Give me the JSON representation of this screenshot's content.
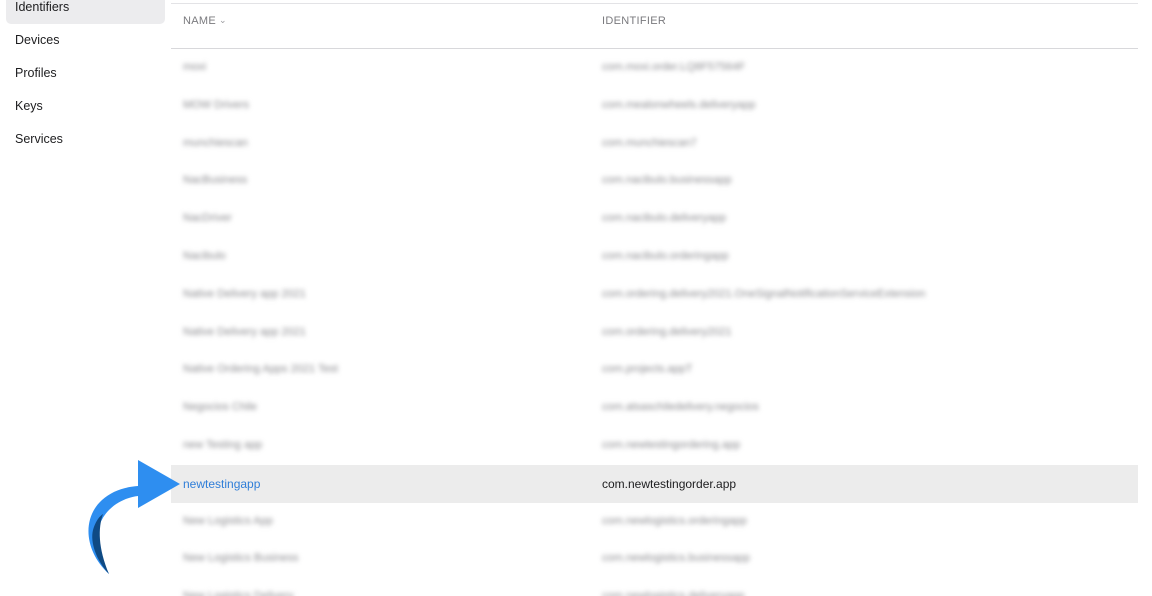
{
  "sidebar": {
    "items": [
      {
        "label": "Identifiers",
        "active": true
      },
      {
        "label": "Devices",
        "active": false
      },
      {
        "label": "Profiles",
        "active": false
      },
      {
        "label": "Keys",
        "active": false
      },
      {
        "label": "Services",
        "active": false
      }
    ]
  },
  "table": {
    "columns": {
      "name": "NAME",
      "identifier": "IDENTIFIER"
    },
    "sort_icon": "chevron-down-icon",
    "rows": [
      {
        "name": "moxi",
        "identifier": "com.moxi.order.LQ8F57564F",
        "blurred": true
      },
      {
        "name": "MOW Drivers",
        "identifier": "com.mealonwheels.deliveryapp",
        "blurred": true
      },
      {
        "name": "munchiescan",
        "identifier": "com.munchiescan7",
        "blurred": true
      },
      {
        "name": "NacBusiness",
        "identifier": "com.nacibulo.businessapp",
        "blurred": true
      },
      {
        "name": "NacDriver",
        "identifier": "com.nacibulo.deliveryapp",
        "blurred": true
      },
      {
        "name": "Nacibulo",
        "identifier": "com.nacibulo.orderingapp",
        "blurred": true
      },
      {
        "name": "Native Delivery app 2021",
        "identifier": "com.ordering.delivery2021.OneSignalNotificationServiceExtension",
        "blurred": true
      },
      {
        "name": "Native Delivery app 2021",
        "identifier": "com.ordering.delivery2021",
        "blurred": true
      },
      {
        "name": "Native Ordering Apps 2021 Test",
        "identifier": "com.projects.appT",
        "blurred": true
      },
      {
        "name": "Negocios Chile",
        "identifier": "com.atsaschiledelivery.negocios",
        "blurred": true
      },
      {
        "name": "new Testing app",
        "identifier": "com.newtestingordering.app",
        "blurred": true
      },
      {
        "name": "newtestingapp",
        "identifier": "com.newtestingorder.app",
        "blurred": false,
        "selected": true
      },
      {
        "name": "New Logistics App",
        "identifier": "com.newlogistics.orderingapp",
        "blurred": true
      },
      {
        "name": "New Logistics Business",
        "identifier": "com.newlogistics.businessapp",
        "blurred": true
      },
      {
        "name": "New Logistics Delivery",
        "identifier": "com.newlogistics.deliveryapp",
        "blurred": true
      }
    ]
  },
  "annotation": {
    "arrow_icon": "curved-arrow-icon",
    "colors": {
      "arrow_light": "#2e8ef0",
      "arrow_dark": "#0f4a84"
    }
  },
  "colors": {
    "link": "#2f7ed8",
    "selected_row_bg": "#ececec",
    "sidebar_active_bg": "#ececee"
  }
}
